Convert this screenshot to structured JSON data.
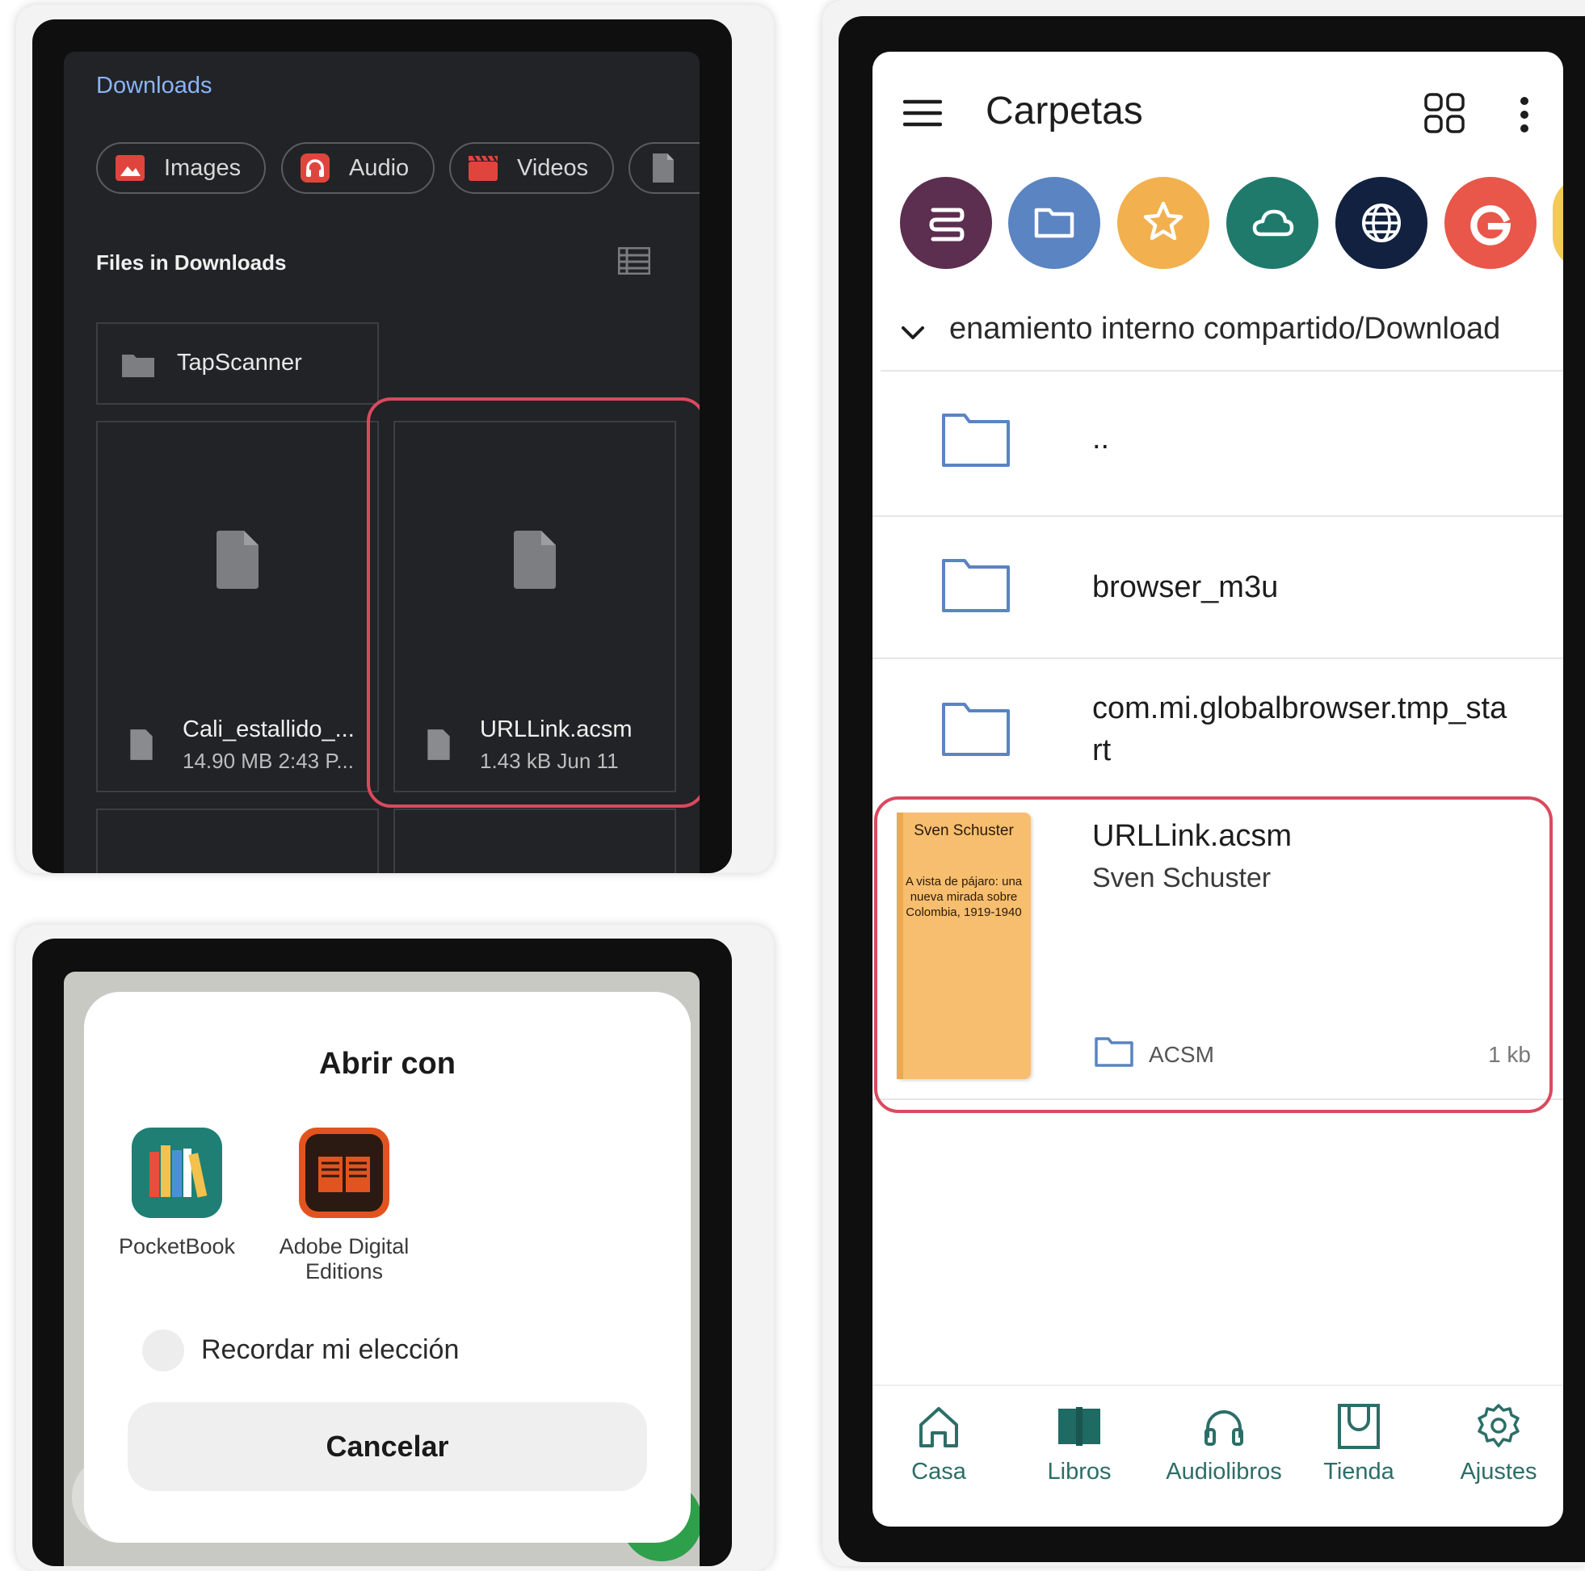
{
  "downloads": {
    "title": "Downloads",
    "chips": [
      {
        "label": "Images",
        "icon": "image-icon"
      },
      {
        "label": "Audio",
        "icon": "headphones-icon"
      },
      {
        "label": "Videos",
        "icon": "clapper-icon"
      },
      {
        "label": "",
        "icon": "document-icon"
      }
    ],
    "section_title": "Files in Downloads",
    "folder": {
      "name": "TapScanner"
    },
    "files": [
      {
        "name": "Cali_estallido_...",
        "meta": "14.90 MB 2:43 P..."
      },
      {
        "name": "URLLink.acsm",
        "meta": "1.43 kB Jun 11"
      }
    ],
    "colors": {
      "accent": "#8ab4f8",
      "highlight": "#d94a5e",
      "chip_icon": "#e0453d"
    }
  },
  "open_with": {
    "title": "Abrir con",
    "apps": [
      {
        "label": "PocketBook",
        "icon": "pocketbook-app-icon"
      },
      {
        "label_line1": "Adobe Digital",
        "label_line2": "Editions",
        "icon": "adobe-digital-editions-icon"
      }
    ],
    "remember_label": "Recordar mi elección",
    "cancel_label": "Cancelar"
  },
  "folders_app": {
    "title": "Carpetas",
    "quick_icons": [
      "storage-icon",
      "folder-icon",
      "star-icon",
      "cloud-icon",
      "globe-icon",
      "google-icon"
    ],
    "path": "enamiento interno compartido/Download",
    "items": [
      {
        "name": ".."
      },
      {
        "name": "browser_m3u"
      },
      {
        "name_line1": "com.mi.globalbrowser.tmp_sta",
        "name_line2": "rt"
      }
    ],
    "book": {
      "title": "URLLink.acsm",
      "author": "Sven Schuster",
      "cover_author": "Sven Schuster",
      "cover_title": "A vista de pájaro: una nueva mirada sobre Colombia, 1919-1940",
      "format": "ACSM",
      "size": "1 kb"
    },
    "nav": [
      {
        "label": "Casa",
        "icon": "home-icon"
      },
      {
        "label": "Libros",
        "icon": "book-icon"
      },
      {
        "label": "Audiolibros",
        "icon": "headphones-icon"
      },
      {
        "label": "Tienda",
        "icon": "store-icon"
      },
      {
        "label": "Ajustes",
        "icon": "settings-icon"
      }
    ],
    "colors": {
      "accent": "#2c6e67",
      "highlight": "#d94a5e",
      "cover": "#f7be6f"
    }
  }
}
